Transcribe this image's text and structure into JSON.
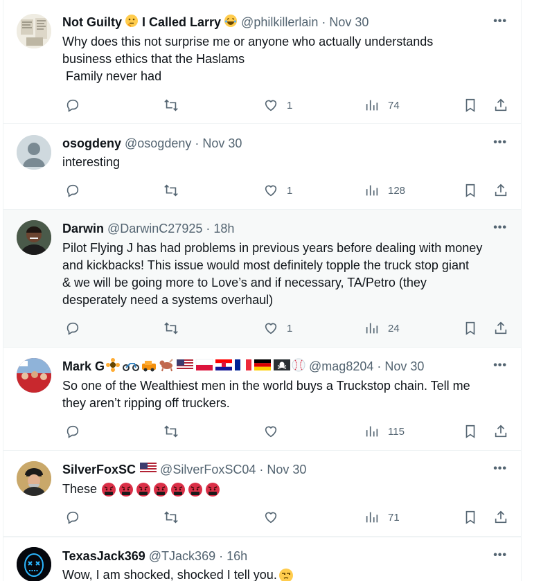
{
  "tweets": [
    {
      "name": "Not Guilty",
      "name_suffix": "I Called Larry",
      "handle": "@philkillerlain",
      "separator": "·",
      "time": "Nov 30",
      "text": "Why does this not surprise me or anyone who actually understands\nbusiness ethics that the Haslams\n Family never had",
      "replies": "",
      "retweets": "",
      "likes": "1",
      "views": "74",
      "highlighted": false
    },
    {
      "name": "osogdeny",
      "handle": "@osogdeny",
      "separator": "·",
      "time": "Nov 30",
      "text": "interesting",
      "replies": "",
      "retweets": "",
      "likes": "1",
      "views": "128",
      "highlighted": false
    },
    {
      "name": "Darwin",
      "handle": "@DarwinC27925",
      "separator": "·",
      "time": "18h",
      "text": "Pilot Flying J has had problems in previous years before dealing with money\nand kickbacks! This issue would most definitely topple the truck stop giant\n& we will be going more to Love’s and if necessary, TA/Petro (they\ndesperately need a systems overhaul)",
      "replies": "",
      "retweets": "",
      "likes": "1",
      "views": "24",
      "highlighted": true
    },
    {
      "name": "Mark G",
      "handle": "@mag8204",
      "separator": "·",
      "time": "Nov 30",
      "text": "So one of the Wealthiest men in the world buys a Truckstop chain. Tell me\nthey aren’t ripping off truckers.",
      "replies": "",
      "retweets": "",
      "likes": "",
      "views": "115",
      "highlighted": false
    },
    {
      "name": "SilverFoxSC",
      "handle": "@SilverFoxSC04",
      "separator": "·",
      "time": "Nov 30",
      "text": "These",
      "replies": "",
      "retweets": "",
      "likes": "",
      "views": "71",
      "highlighted": false
    },
    {
      "name": "TexasJack369",
      "handle": "@TJack369",
      "separator": "·",
      "time": "16h",
      "text": "Wow, I am shocked, shocked I tell you.",
      "highlighted": false
    }
  ],
  "more_label": "•••",
  "icons": {
    "reply": "reply-icon",
    "retweet": "retweet-icon",
    "like": "heart-icon",
    "views": "views-chart-icon",
    "bookmark": "bookmark-icon",
    "share": "share-icon",
    "more": "more-options-icon"
  },
  "colors": {
    "text": "#0f1419",
    "secondary": "#536471",
    "highlight_bg": "#f7f9f9",
    "border": "#eff3f4"
  }
}
